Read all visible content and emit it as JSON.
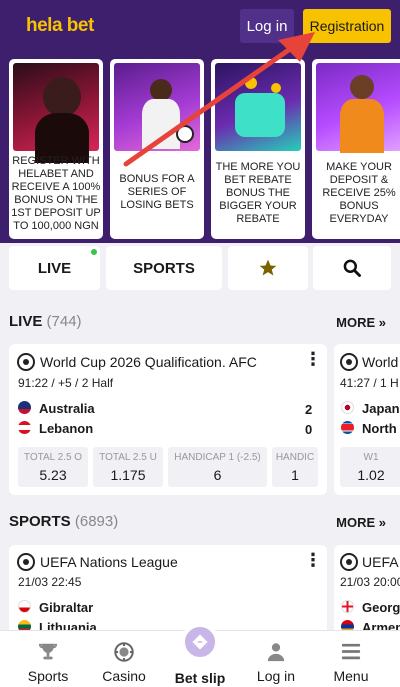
{
  "header": {
    "logo": "hela bet",
    "login_label": "Log in",
    "registration_label": "Registration"
  },
  "promos": [
    {
      "text": "REGISTER WITH HELABET AND RECEIVE A 100% BONUS ON THE 1ST DEPOSIT UP TO 100,000 NGN"
    },
    {
      "text": "BONUS FOR A SERIES OF LOSING BETS"
    },
    {
      "text": "THE MORE YOU BET REBATE BONUS THE BIGGER YOUR REBATE"
    },
    {
      "text": "MAKE YOUR DEPOSIT & RECEIVE 25% BONUS EVERYDAY"
    }
  ],
  "tabs": {
    "live": "LIVE",
    "sports": "SPORTS",
    "favorites_icon": "star-icon",
    "search_icon": "search-icon"
  },
  "live_section": {
    "title": "LIVE",
    "count": "(744)",
    "more_label": "MORE »",
    "match": {
      "league": "World Cup 2026 Qualification. AFC",
      "time": "91:22 / +5 / 2 Half",
      "team1": "Australia",
      "team2": "Lebanon",
      "score1": "2",
      "score2": "0",
      "odds": [
        {
          "label": "TOTAL 2.5 O",
          "value": "5.23"
        },
        {
          "label": "TOTAL 2.5 U",
          "value": "1.175"
        },
        {
          "label": "HANDICAP 1 (-2.5)",
          "value": "6"
        },
        {
          "label": "HANDIC",
          "value": "1"
        }
      ]
    },
    "match2": {
      "league": "World",
      "time": "41:27 / 1 H",
      "team1": "Japan",
      "team2": "North",
      "odd_label": "W1",
      "odd_value": "1.02"
    }
  },
  "sports_section": {
    "title": "SPORTS",
    "count": "(6893)",
    "more_label": "MORE »",
    "match": {
      "league": "UEFA Nations League",
      "time": "21/03 22:45",
      "team1": "Gibraltar",
      "team2": "Lithuania"
    },
    "match2": {
      "league": "UEFA E",
      "time": "21/03 20:00",
      "team1": "Georgi",
      "team2": "Armeni"
    }
  },
  "bottom_nav": [
    {
      "label": "Sports",
      "icon": "trophy-icon"
    },
    {
      "label": "Casino",
      "icon": "casino-chip-icon"
    },
    {
      "label": "Bet slip",
      "icon": "ticket-icon"
    },
    {
      "label": "Log in",
      "icon": "user-icon"
    },
    {
      "label": "Menu",
      "icon": "menu-icon"
    }
  ],
  "colors": {
    "header_bg": "#3d1f6e",
    "accent": "#f7c200",
    "arrow": "#e8433a"
  }
}
